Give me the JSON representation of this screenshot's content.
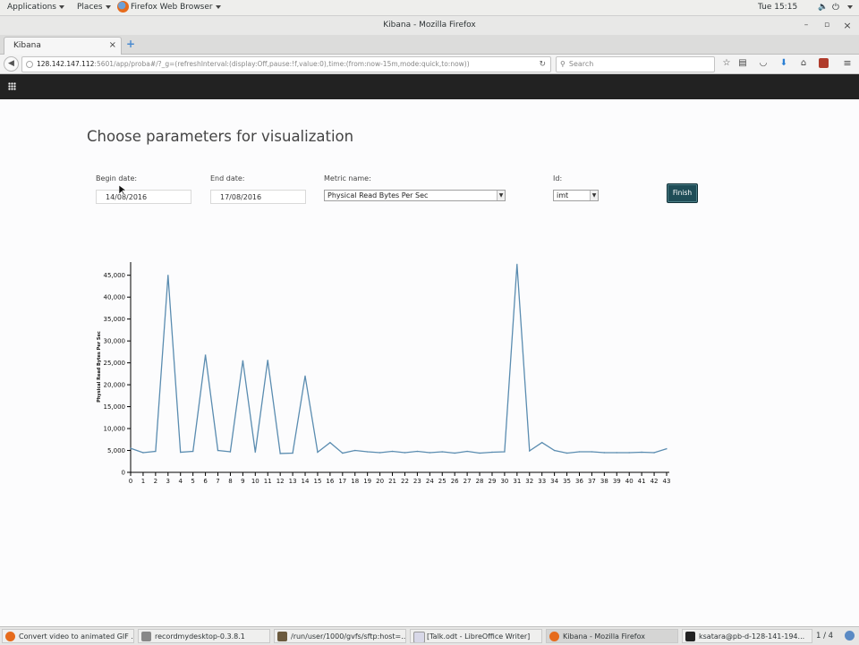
{
  "top_panel": {
    "applications": "Applications",
    "places": "Places",
    "browser_app": "Firefox Web Browser",
    "clock": "Tue 15:15"
  },
  "window": {
    "title": "Kibana - Mozilla Firefox",
    "minimize": "–",
    "maximize": "▫",
    "close": "×"
  },
  "tabs": [
    {
      "label": "Kibana",
      "close": "×"
    }
  ],
  "new_tab": "+",
  "navbar": {
    "url_host": "128.142.147.112",
    "url_rest": ":5601/app/proba#/?_g=(refreshInterval:(display:Off,pause:!f,value:0),time:(from:now-15m,mode:quick,to:now))",
    "search_placeholder": "Search",
    "icons": [
      "star-icon",
      "reading-list-icon",
      "pocket-icon",
      "download-icon",
      "home-icon",
      "addon-icon",
      "menu-icon"
    ]
  },
  "page": {
    "title": "Choose parameters for visualization",
    "begin_label": "Begin date:",
    "begin_value": "14/08/2016",
    "end_label": "End date:",
    "end_value": "17/08/2016",
    "metric_label": "Metric name:",
    "metric_value": "Physical Read Bytes Per Sec",
    "id_label": "Id:",
    "id_value": "imt",
    "finish": "Finish"
  },
  "chart_data": {
    "type": "line",
    "title": "",
    "xlabel": "",
    "ylabel": "Physical Read Bytes Per Sec",
    "x": [
      0,
      1,
      2,
      3,
      4,
      5,
      6,
      7,
      8,
      9,
      10,
      11,
      12,
      13,
      14,
      15,
      16,
      17,
      18,
      19,
      20,
      21,
      22,
      23,
      24,
      25,
      26,
      27,
      28,
      29,
      30,
      31,
      32,
      33,
      34,
      35,
      36,
      37,
      38,
      39,
      40,
      41,
      42,
      43
    ],
    "values": [
      5500,
      4500,
      4800,
      45000,
      4600,
      4800,
      26800,
      5000,
      4700,
      25500,
      4600,
      25600,
      4300,
      4400,
      22000,
      4600,
      6800,
      4400,
      5000,
      4700,
      4500,
      4800,
      4500,
      4800,
      4500,
      4700,
      4400,
      4800,
      4400,
      4600,
      4700,
      47500,
      4900,
      6800,
      5000,
      4400,
      4700,
      4700,
      4500,
      4500,
      4500,
      4600,
      4500,
      5400
    ],
    "xlim": [
      0,
      43
    ],
    "ylim": [
      0,
      48000
    ],
    "y_ticks": [
      0,
      5000,
      10000,
      15000,
      20000,
      25000,
      30000,
      35000,
      40000,
      45000
    ],
    "y_tick_labels": [
      "0",
      "5,000",
      "10,000",
      "15,000",
      "20,000",
      "25,000",
      "30,000",
      "35,000",
      "40,000",
      "45,000"
    ],
    "line_color": "#5a8cb0",
    "grid": false
  },
  "taskbar": {
    "items": [
      "Convert video to animated GIF ...",
      "recordmydesktop-0.3.8.1",
      "/run/user/1000/gvfs/sftp:host=...",
      "[Talk.odt - LibreOffice Writer]",
      "Kibana - Mozilla Firefox",
      "ksatara@pb-d-128-141-194..."
    ],
    "workspace": "1 / 4"
  }
}
